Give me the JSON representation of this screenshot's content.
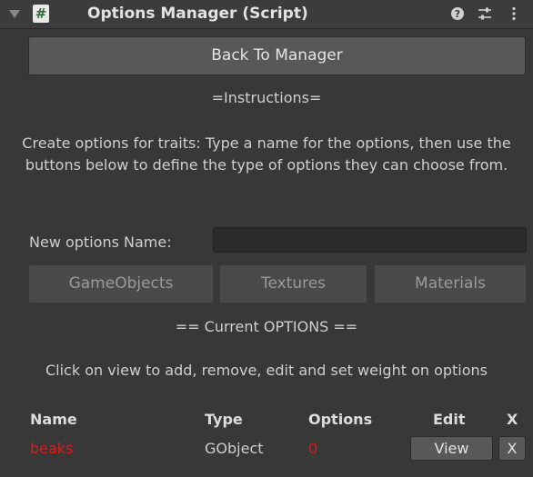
{
  "header": {
    "title": "Options Manager (Script)",
    "script_icon_text": "#",
    "icons": [
      "fold-arrow-icon",
      "script-icon",
      "help-icon",
      "settings-icon",
      "more-icon"
    ]
  },
  "back_button": "Back To Manager",
  "instructions": {
    "heading": "=Instructions=",
    "body": "Create options for traits: Type a name for the options, then use the buttons below to define the type of options they can choose from."
  },
  "new_options": {
    "label": "New options Name:",
    "value": "",
    "placeholder": ""
  },
  "type_buttons": [
    "GameObjects",
    "Textures",
    "Materials"
  ],
  "current_options": {
    "heading": "== Current OPTIONS ==",
    "body": "Click on view to add, remove, edit and set weight on options"
  },
  "table": {
    "headers": [
      "Name",
      "Type",
      "Options",
      "Edit",
      "X"
    ],
    "rows": [
      {
        "name": "beaks",
        "type": "GObject",
        "options": "0",
        "edit_label": "View",
        "delete_label": "X"
      }
    ]
  },
  "colors": {
    "background": "#383838",
    "highlight_red": "#e01a1a"
  }
}
